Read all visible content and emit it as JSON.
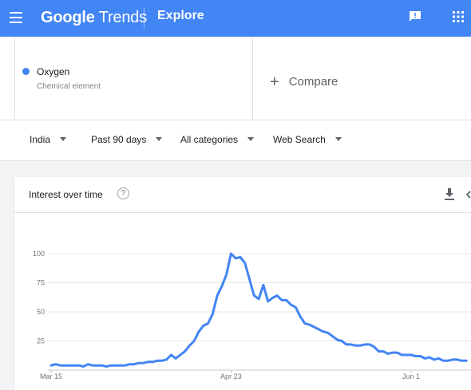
{
  "header": {
    "logo_google": "Google",
    "logo_trends": "Trends",
    "section": "Explore",
    "icons": [
      "menu-icon",
      "feedback-icon",
      "apps-icon"
    ]
  },
  "term": {
    "name": "Oxygen",
    "type": "Chemical element",
    "color": "#4285f4"
  },
  "compare_label": "Compare",
  "filters": {
    "region": "India",
    "time": "Past 90 days",
    "category": "All categories",
    "search_type": "Web Search"
  },
  "card": {
    "title": "Interest over time"
  },
  "chart_data": {
    "type": "line",
    "ylim": [
      0,
      100
    ],
    "yticks": [
      25,
      50,
      75,
      100
    ],
    "ytick_labels": [
      "25",
      "50",
      "75",
      "100"
    ],
    "x_tick_labels": [
      {
        "index": 0,
        "label": "Mar 15"
      },
      {
        "index": 39,
        "label": "Apr 23"
      },
      {
        "index": 78,
        "label": "Jun 1"
      }
    ],
    "series": [
      {
        "color": "#4285f4",
        "values": [
          4,
          5,
          4,
          4,
          4,
          4,
          4,
          3,
          5,
          4,
          4,
          4,
          3,
          4,
          4,
          4,
          4,
          5,
          5,
          6,
          6,
          7,
          7,
          8,
          8,
          9,
          13,
          10,
          13,
          16,
          21,
          25,
          33,
          38,
          40,
          48,
          64,
          72,
          82,
          100,
          96,
          97,
          92,
          78,
          64,
          61,
          73,
          59,
          62,
          64,
          60,
          60,
          56,
          54,
          46,
          40,
          39,
          37,
          35,
          33,
          32,
          29,
          26,
          25,
          22,
          22,
          21,
          21,
          22,
          22,
          20,
          16,
          16,
          14,
          15,
          15,
          13,
          13,
          13,
          12,
          12,
          10,
          11,
          9,
          10,
          8,
          8,
          9,
          9,
          8,
          8
        ]
      }
    ]
  }
}
